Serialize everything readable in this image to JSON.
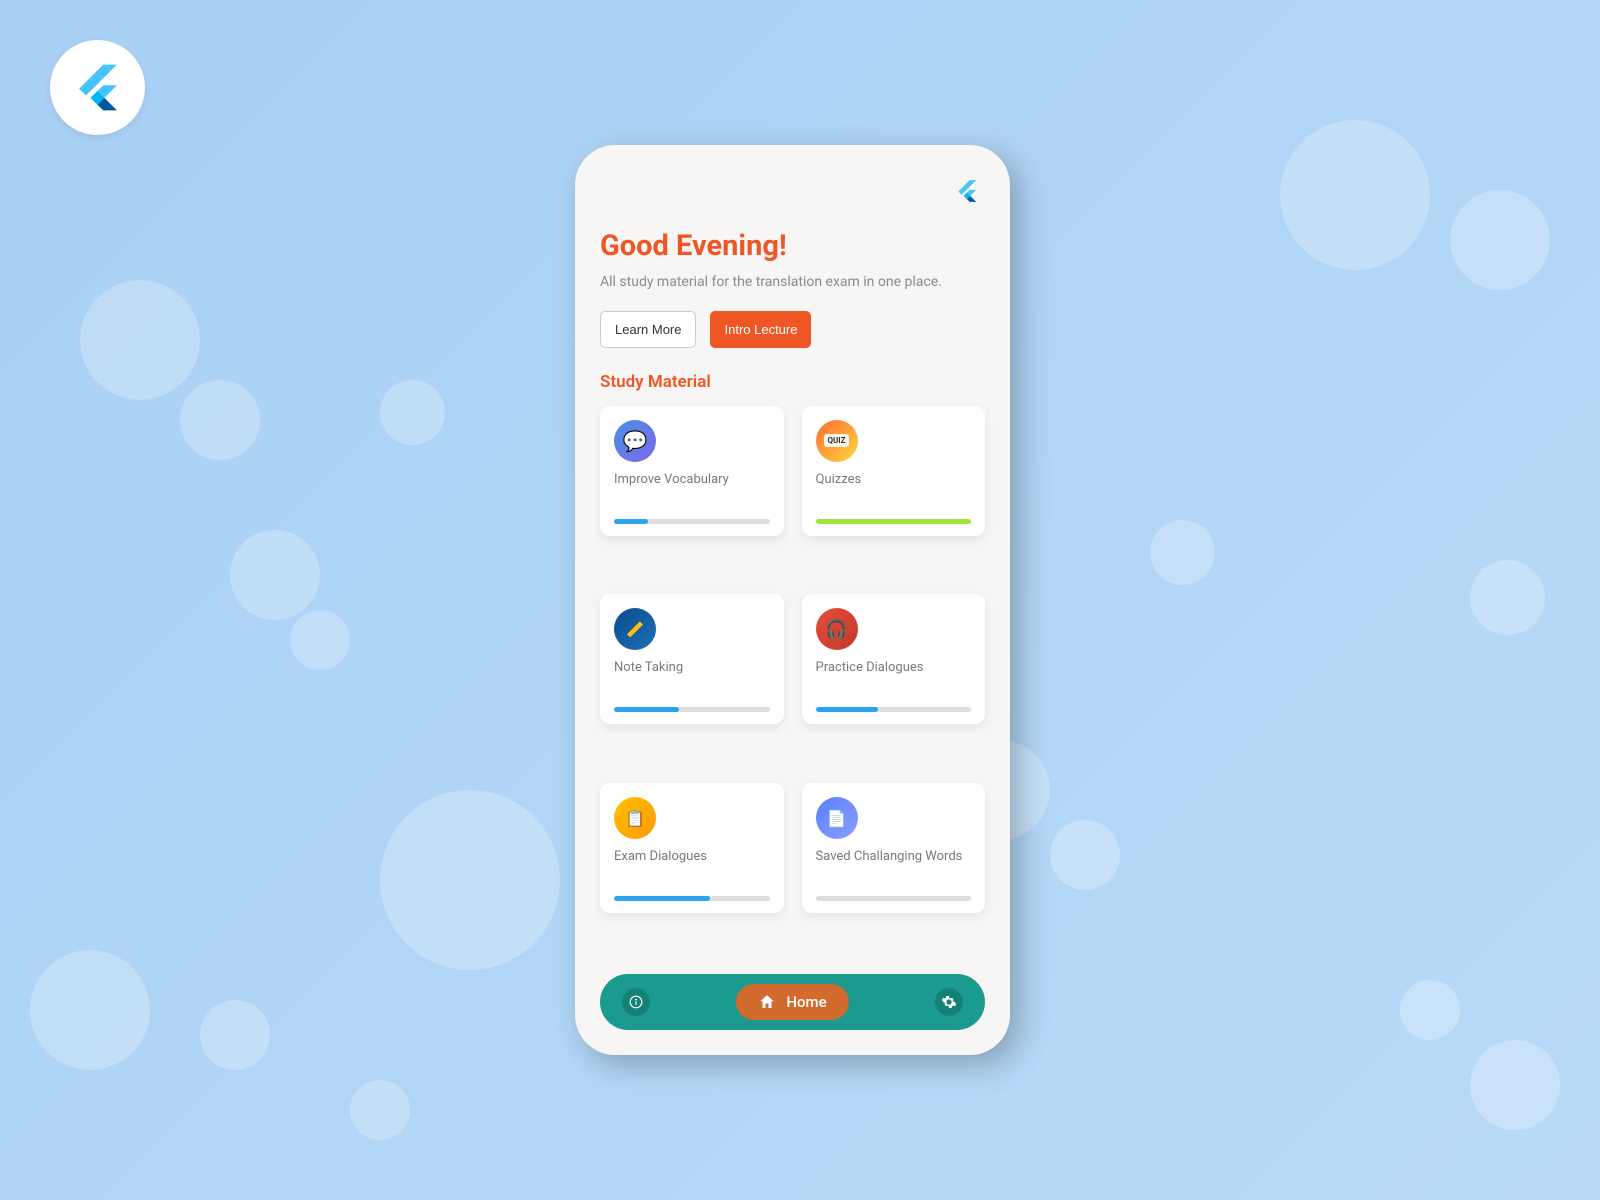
{
  "header": {
    "greeting": "Good Evening!",
    "subtitle": "All study material for the translation exam in one place.",
    "learn_more": "Learn More",
    "intro_lecture": "Intro Lecture"
  },
  "section_title": "Study Material",
  "cards": [
    {
      "title": "Improve Vocabulary",
      "progress": 22,
      "color": "#2aa3ef"
    },
    {
      "title": "Quizzes",
      "progress": 100,
      "color": "#9fe63a"
    },
    {
      "title": "Note Taking",
      "progress": 42,
      "color": "#2aa3ef"
    },
    {
      "title": "Practice Dialogues",
      "progress": 40,
      "color": "#2aa3ef"
    },
    {
      "title": "Exam Dialogues",
      "progress": 62,
      "color": "#2aa3ef"
    },
    {
      "title": "Saved Challanging Words",
      "progress": 0,
      "color": "#2aa3ef"
    }
  ],
  "nav": {
    "home_label": "Home"
  },
  "colors": {
    "accent": "#f05524",
    "nav_bg": "#1a9b8e",
    "nav_active": "#d36a2e"
  }
}
